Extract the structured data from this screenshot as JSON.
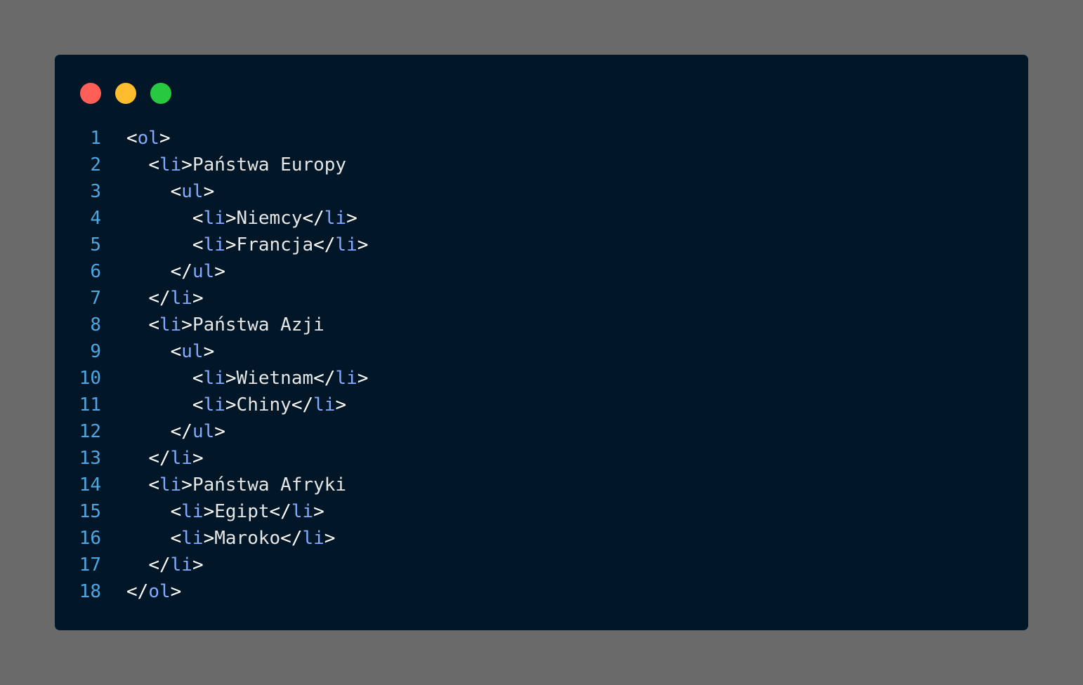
{
  "colors": {
    "background": "#6a6a6a",
    "editor_background": "#011627",
    "line_number": "#4fa6e0",
    "punctuation": "#ffffff",
    "tag": "#82aaff",
    "text": "#e6e6e6",
    "dot_close": "#ff5f57",
    "dot_minimize": "#ffbd2e",
    "dot_maximize": "#28c940"
  },
  "window_controls": [
    "close-dot",
    "minimize-dot",
    "maximize-dot"
  ],
  "code": {
    "lines": [
      {
        "n": "1",
        "indent": "",
        "parts": [
          [
            "p",
            "<"
          ],
          [
            "t",
            "ol"
          ],
          [
            "p",
            ">"
          ]
        ]
      },
      {
        "n": "2",
        "indent": "  ",
        "parts": [
          [
            "p",
            "<"
          ],
          [
            "t",
            "li"
          ],
          [
            "p",
            ">"
          ],
          [
            "x",
            "Państwa Europy"
          ]
        ]
      },
      {
        "n": "3",
        "indent": "    ",
        "parts": [
          [
            "p",
            "<"
          ],
          [
            "t",
            "ul"
          ],
          [
            "p",
            ">"
          ]
        ]
      },
      {
        "n": "4",
        "indent": "      ",
        "parts": [
          [
            "p",
            "<"
          ],
          [
            "t",
            "li"
          ],
          [
            "p",
            ">"
          ],
          [
            "x",
            "Niemcy"
          ],
          [
            "p",
            "</"
          ],
          [
            "t",
            "li"
          ],
          [
            "p",
            ">"
          ]
        ]
      },
      {
        "n": "5",
        "indent": "      ",
        "parts": [
          [
            "p",
            "<"
          ],
          [
            "t",
            "li"
          ],
          [
            "p",
            ">"
          ],
          [
            "x",
            "Francja"
          ],
          [
            "p",
            "</"
          ],
          [
            "t",
            "li"
          ],
          [
            "p",
            ">"
          ]
        ]
      },
      {
        "n": "6",
        "indent": "    ",
        "parts": [
          [
            "p",
            "</"
          ],
          [
            "t",
            "ul"
          ],
          [
            "p",
            ">"
          ]
        ]
      },
      {
        "n": "7",
        "indent": "  ",
        "parts": [
          [
            "p",
            "</"
          ],
          [
            "t",
            "li"
          ],
          [
            "p",
            ">"
          ]
        ]
      },
      {
        "n": "8",
        "indent": "  ",
        "parts": [
          [
            "p",
            "<"
          ],
          [
            "t",
            "li"
          ],
          [
            "p",
            ">"
          ],
          [
            "x",
            "Państwa Azji"
          ]
        ]
      },
      {
        "n": "9",
        "indent": "    ",
        "parts": [
          [
            "p",
            "<"
          ],
          [
            "t",
            "ul"
          ],
          [
            "p",
            ">"
          ]
        ]
      },
      {
        "n": "10",
        "indent": "      ",
        "parts": [
          [
            "p",
            "<"
          ],
          [
            "t",
            "li"
          ],
          [
            "p",
            ">"
          ],
          [
            "x",
            "Wietnam"
          ],
          [
            "p",
            "</"
          ],
          [
            "t",
            "li"
          ],
          [
            "p",
            ">"
          ]
        ]
      },
      {
        "n": "11",
        "indent": "      ",
        "parts": [
          [
            "p",
            "<"
          ],
          [
            "t",
            "li"
          ],
          [
            "p",
            ">"
          ],
          [
            "x",
            "Chiny"
          ],
          [
            "p",
            "</"
          ],
          [
            "t",
            "li"
          ],
          [
            "p",
            ">"
          ]
        ]
      },
      {
        "n": "12",
        "indent": "    ",
        "parts": [
          [
            "p",
            "</"
          ],
          [
            "t",
            "ul"
          ],
          [
            "p",
            ">"
          ]
        ]
      },
      {
        "n": "13",
        "indent": "  ",
        "parts": [
          [
            "p",
            "</"
          ],
          [
            "t",
            "li"
          ],
          [
            "p",
            ">"
          ]
        ]
      },
      {
        "n": "14",
        "indent": "  ",
        "parts": [
          [
            "p",
            "<"
          ],
          [
            "t",
            "li"
          ],
          [
            "p",
            ">"
          ],
          [
            "x",
            "Państwa Afryki"
          ]
        ]
      },
      {
        "n": "15",
        "indent": "    ",
        "parts": [
          [
            "p",
            "<"
          ],
          [
            "t",
            "li"
          ],
          [
            "p",
            ">"
          ],
          [
            "x",
            "Egipt"
          ],
          [
            "p",
            "</"
          ],
          [
            "t",
            "li"
          ],
          [
            "p",
            ">"
          ]
        ]
      },
      {
        "n": "16",
        "indent": "    ",
        "parts": [
          [
            "p",
            "<"
          ],
          [
            "t",
            "li"
          ],
          [
            "p",
            ">"
          ],
          [
            "x",
            "Maroko"
          ],
          [
            "p",
            "</"
          ],
          [
            "t",
            "li"
          ],
          [
            "p",
            ">"
          ]
        ]
      },
      {
        "n": "17",
        "indent": "  ",
        "parts": [
          [
            "p",
            "</"
          ],
          [
            "t",
            "li"
          ],
          [
            "p",
            ">"
          ]
        ]
      },
      {
        "n": "18",
        "indent": "",
        "parts": [
          [
            "p",
            "</"
          ],
          [
            "t",
            "ol"
          ],
          [
            "p",
            ">"
          ]
        ]
      }
    ]
  }
}
